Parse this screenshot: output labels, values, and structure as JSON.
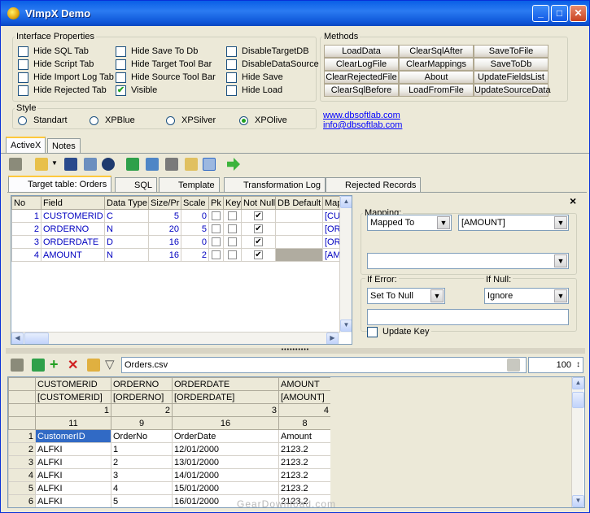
{
  "window": {
    "title": "VImpX Demo"
  },
  "interface": {
    "legend": "Interface Properties",
    "options": [
      {
        "label": "Hide SQL Tab",
        "checked": false
      },
      {
        "label": "Hide Script Tab",
        "checked": false
      },
      {
        "label": "Hide Import Log Tab",
        "checked": false
      },
      {
        "label": "Hide Rejected Tab",
        "checked": false
      },
      {
        "label": "Hide Save To Db",
        "checked": false
      },
      {
        "label": "Hide Target Tool Bar",
        "checked": false
      },
      {
        "label": "Hide Source Tool Bar",
        "checked": false
      },
      {
        "label": "Visible",
        "checked": true
      },
      {
        "label": "DisableTargetDB",
        "checked": false
      },
      {
        "label": "DisableDataSource",
        "checked": false
      },
      {
        "label": "Hide Save",
        "checked": false
      },
      {
        "label": "Hide Load",
        "checked": false
      }
    ]
  },
  "methods": {
    "legend": "Methods",
    "buttons": [
      "LoadData",
      "ClearSqlAfter",
      "SaveToFile",
      "ClearLogFile",
      "ClearMappings",
      "SaveToDb",
      "ClearRejectedFile",
      "About",
      "UpdateFieldsList",
      "ClearSqlBefore",
      "LoadFromFile",
      "UpdateSourceData"
    ]
  },
  "style": {
    "legend": "Style",
    "options": [
      {
        "label": "Standart",
        "selected": false
      },
      {
        "label": "XPBlue",
        "selected": false
      },
      {
        "label": "XPSilver",
        "selected": false
      },
      {
        "label": "XPOlive",
        "selected": true
      }
    ]
  },
  "links": [
    "www.dbsoftlab.com",
    "info@dbsoftlab.com"
  ],
  "main_tabs": [
    "ActiveX",
    "Notes"
  ],
  "sub_tabs": [
    "Target table: Orders",
    "SQL",
    "Template",
    "Transformation Log",
    "Rejected Records"
  ],
  "target_grid": {
    "headers": [
      "No",
      "Field",
      "Data Type",
      "Size/Pr",
      "Scale",
      "Pk",
      "Key",
      "Not Null",
      "DB Default",
      "Map"
    ],
    "rows": [
      [
        "1",
        "CUSTOMERID",
        "C",
        "5",
        "0",
        "",
        "",
        "✔",
        "",
        "[CUS"
      ],
      [
        "2",
        "ORDERNO",
        "N",
        "20",
        "5",
        "",
        "",
        "✔",
        "",
        "[ORD"
      ],
      [
        "3",
        "ORDERDATE",
        "D",
        "16",
        "0",
        "",
        "",
        "✔",
        "",
        "[ORD"
      ],
      [
        "4",
        "AMOUNT",
        "N",
        "16",
        "2",
        "",
        "",
        "✔",
        "",
        "[AMO"
      ]
    ]
  },
  "mapping": {
    "legend": "Mapping:",
    "mode": "Mapped To",
    "target": "[AMOUNT]",
    "expression": "",
    "if_error_label": "If Error:",
    "if_error": "Set To Null",
    "if_null_label": "If Null:",
    "if_null": "Ignore",
    "default_value": "",
    "update_key": "Update Key",
    "close": "×"
  },
  "source": {
    "file": "Orders.csv",
    "zoom": "100",
    "headers": [
      "CUSTOMERID",
      "ORDERNO",
      "ORDERDATE",
      "AMOUNT"
    ],
    "mapped": [
      "[CUSTOMERID]",
      "[ORDERNO]",
      "[ORDERDATE]",
      "[AMOUNT]"
    ],
    "index": [
      "1",
      "2",
      "3",
      "4"
    ],
    "widths": [
      "11",
      "9",
      "16",
      "8"
    ],
    "rows": [
      [
        "1",
        "CustomerID",
        "OrderNo",
        "OrderDate",
        "Amount"
      ],
      [
        "2",
        "ALFKI",
        "1",
        "12/01/2000",
        "2123.2"
      ],
      [
        "3",
        "ALFKI",
        "2",
        "13/01/2000",
        "2123.2"
      ],
      [
        "4",
        "ALFKI",
        "3",
        "14/01/2000",
        "2123.2"
      ],
      [
        "5",
        "ALFKI",
        "4",
        "15/01/2000",
        "2123.2"
      ],
      [
        "6",
        "ALFKI",
        "5",
        "16/01/2000",
        "2123.2"
      ]
    ]
  },
  "watermark": "GearDownload.com"
}
